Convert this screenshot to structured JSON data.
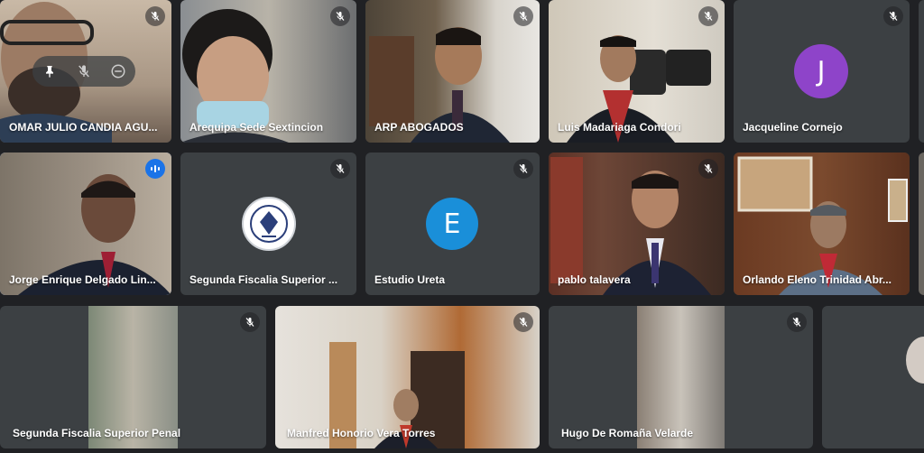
{
  "participants": [
    {
      "name": "OMAR JULIO CANDIA AGU..."
    },
    {
      "name": "Arequipa Sede Sextincion"
    },
    {
      "name": "ARP ABOGADOS"
    },
    {
      "name": "Luis Madariaga Condori"
    },
    {
      "name": "Jacqueline Cornejo",
      "avatar_letter": "J"
    },
    {
      "name": "Jorge Enrique Delgado Lin..."
    },
    {
      "name": "Segunda Fiscalia Superior ..."
    },
    {
      "name": "Estudio Ureta",
      "avatar_letter": "E"
    },
    {
      "name": "pablo talavera"
    },
    {
      "name": "Orlando Eleno Trinidad Abr..."
    },
    {
      "name": "Segunda Fiscalia Superior Penal"
    },
    {
      "name": "Manfred Honorio Vera Torres"
    },
    {
      "name": "Hugo De Romaña Velarde"
    }
  ],
  "colors": {
    "background": "#202124",
    "tile": "#3c4043",
    "active_border": "#8ab4f8",
    "avatar_purple": "#8e44c9",
    "avatar_blue": "#1a8fd9",
    "speaking_badge": "#1a73e8"
  },
  "icons": {
    "muted": "mic-off-icon",
    "speaking": "audio-level-icon",
    "pin": "pin-icon",
    "remove": "remove-icon"
  }
}
